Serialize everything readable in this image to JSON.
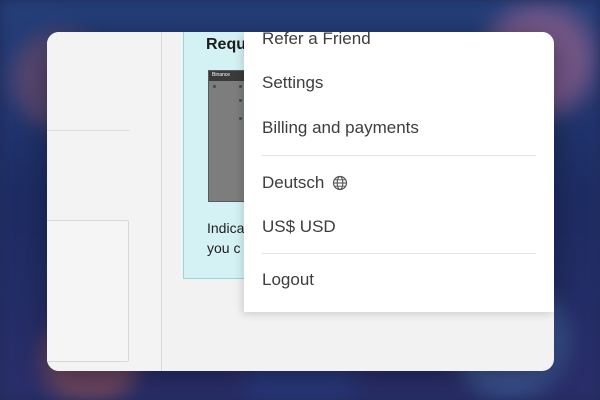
{
  "promo": {
    "title": "Requ",
    "thumb_text": "Binance",
    "desc_line1": "Indica",
    "desc_line2": "you c"
  },
  "menu": {
    "items": [
      {
        "label": "Refer a Friend"
      },
      {
        "label": "Settings"
      },
      {
        "label": "Billing and payments"
      },
      {
        "label": "Deutsch"
      },
      {
        "label": "US$ USD"
      },
      {
        "label": "Logout"
      }
    ],
    "language_icon": "globe-icon"
  }
}
